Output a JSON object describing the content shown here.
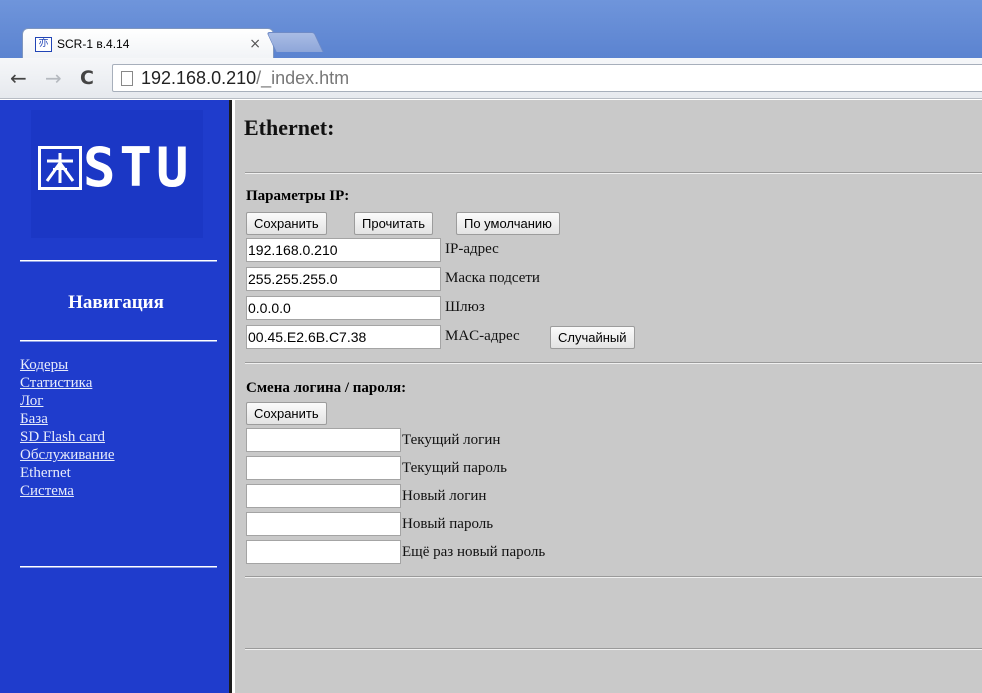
{
  "browser": {
    "tab_title": "SCR-1 в.4.14",
    "tab_close": "×",
    "url_host": "192.168.0.210",
    "url_path": "/_index.htm",
    "back": "←",
    "forward": "→",
    "reload": "C"
  },
  "sidebar": {
    "logo_text": "STU",
    "heading": "Навигация",
    "links": [
      "Кодеры",
      "Статистика",
      "Лог",
      "База",
      "SD Flash card",
      "Обслуживание",
      "Ethernet",
      "Система"
    ]
  },
  "page": {
    "title": "Ethernet:",
    "ip_section": {
      "title": "Параметры IP:",
      "buttons": {
        "save": "Сохранить",
        "read": "Прочитать",
        "default": "По умолчанию"
      },
      "fields": [
        {
          "value": "192.168.0.210",
          "label": "IP-адрес"
        },
        {
          "value": "255.255.255.0",
          "label": "Маска подсети"
        },
        {
          "value": "0.0.0.0",
          "label": "Шлюз"
        },
        {
          "value": "00.45.E2.6B.C7.38",
          "label": "MAC-адрес"
        }
      ],
      "random_button": "Случайный"
    },
    "login_section": {
      "title": "Смена логина / пароля:",
      "save_button": "Сохранить",
      "fields": [
        {
          "value": "",
          "label": "Текущий логин"
        },
        {
          "value": "",
          "label": "Текущий пароль"
        },
        {
          "value": "",
          "label": "Новый логин"
        },
        {
          "value": "",
          "label": "Новый пароль"
        },
        {
          "value": "",
          "label": "Ещё раз новый пароль"
        }
      ]
    }
  }
}
